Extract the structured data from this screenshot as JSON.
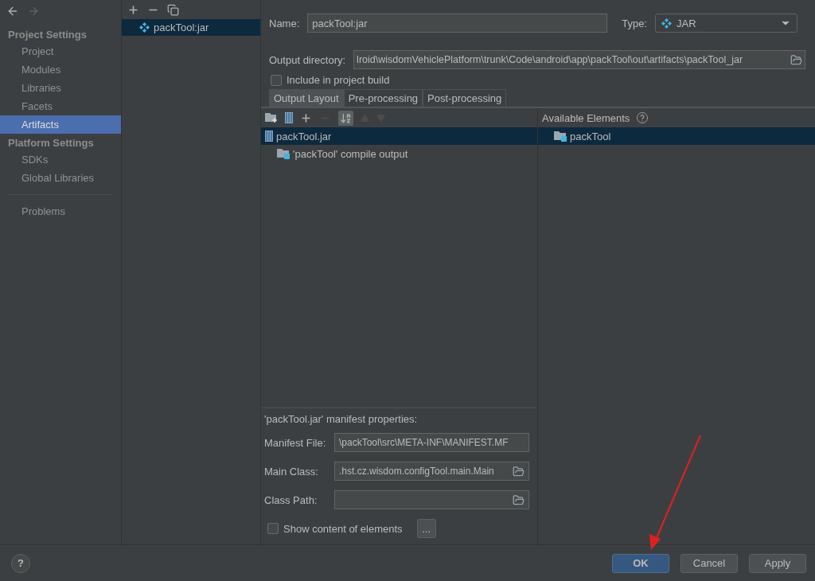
{
  "nav_buttons": [
    {
      "kind": "back",
      "disabled": false
    },
    {
      "kind": "forward",
      "disabled": true
    }
  ],
  "sidebar": {
    "sections": [
      {
        "title": "Project Settings",
        "items": [
          {
            "label": "Project",
            "selected": false
          },
          {
            "label": "Modules",
            "selected": false
          },
          {
            "label": "Libraries",
            "selected": false
          },
          {
            "label": "Facets",
            "selected": false
          },
          {
            "label": "Artifacts",
            "selected": true
          }
        ]
      },
      {
        "title": "Platform Settings",
        "items": [
          {
            "label": "SDKs",
            "selected": false
          },
          {
            "label": "Global Libraries",
            "selected": false
          }
        ]
      }
    ],
    "extra_items": [
      {
        "label": "Problems",
        "selected": false
      }
    ]
  },
  "artifact_toolbar": [
    {
      "kind": "add",
      "disabled": false
    },
    {
      "kind": "remove",
      "disabled": false
    },
    {
      "kind": "copy",
      "disabled": false
    }
  ],
  "artifacts": [
    {
      "label": "packTool:jar",
      "selected": true
    }
  ],
  "form": {
    "name_label": "Name:",
    "name_value": "packTool:jar",
    "type_label": "Type:",
    "type_value": "JAR",
    "output_label": "Output directory:",
    "output_value": "lroid\\wisdomVehiclePlatform\\trunk\\Code\\android\\app\\packTool\\out\\artifacts\\packTool_jar",
    "include_label": "Include in project build",
    "include_checked": false
  },
  "tabs": [
    {
      "label": "Output Layout",
      "selected": true
    },
    {
      "label": "Pre-processing",
      "selected": false
    },
    {
      "label": "Post-processing",
      "selected": false
    }
  ],
  "layout_toolbar": [
    {
      "kind": "new-folder",
      "disabled": false,
      "on": false
    },
    {
      "kind": "jar",
      "disabled": false,
      "on": false
    },
    {
      "kind": "add",
      "disabled": false,
      "on": false
    },
    {
      "kind": "remove",
      "disabled": true,
      "on": false
    },
    {
      "kind": "sort",
      "disabled": false,
      "on": true
    },
    {
      "kind": "up",
      "disabled": true,
      "on": false
    },
    {
      "kind": "down",
      "disabled": true,
      "on": false
    }
  ],
  "output_tree": [
    {
      "label": "packTool.jar",
      "kind": "jar",
      "selected": true,
      "children": [
        {
          "label": "'packTool' compile output",
          "kind": "module-output",
          "selected": false
        }
      ]
    }
  ],
  "available": {
    "title": "Available Elements",
    "items": [
      {
        "label": "packTool",
        "selected": true
      }
    ]
  },
  "manifest": {
    "title": "'packTool.jar' manifest properties:",
    "fields": [
      {
        "label": "Manifest File:",
        "value": "\\packTool\\src\\META-INF\\MANIFEST.MF",
        "browse": false
      },
      {
        "label": "Main Class:",
        "value": ".hst.cz.wisdom.configTool.main.Main",
        "browse": true
      },
      {
        "label": "Class Path:",
        "browse": true
      }
    ]
  },
  "show_content": {
    "label": "Show content of elements",
    "checked": false,
    "button": "..."
  },
  "help_button": "?",
  "buttons": [
    {
      "label": "OK",
      "default": true
    },
    {
      "label": "Cancel",
      "default": false
    },
    {
      "label": "Apply",
      "default": false
    }
  ]
}
